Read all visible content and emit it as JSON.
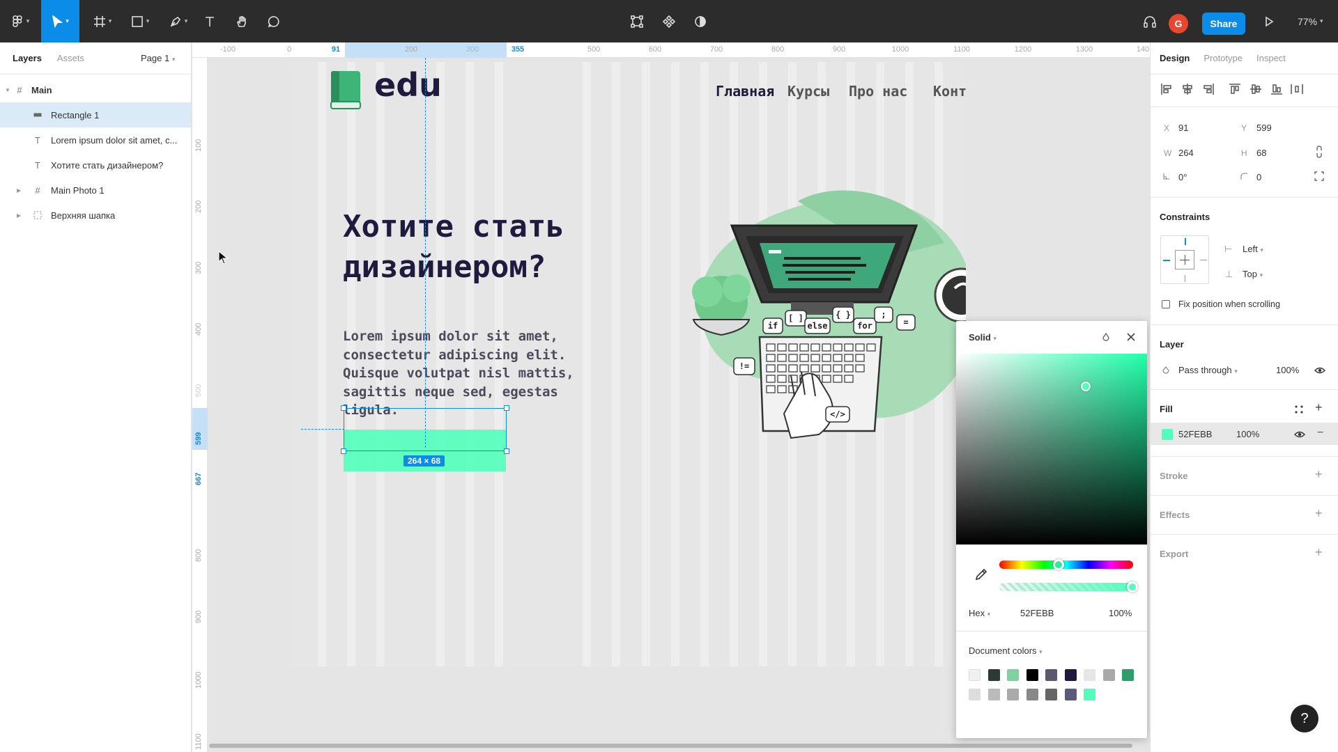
{
  "toolbar": {
    "share_label": "Share",
    "avatar_initial": "G",
    "zoom": "77%"
  },
  "left_panel": {
    "tabs": [
      "Layers",
      "Assets"
    ],
    "page": "Page 1",
    "layers": [
      {
        "label": "Main",
        "type": "frame"
      },
      {
        "label": "Rectangle 1",
        "type": "rect"
      },
      {
        "label": "Lorem ipsum dolor sit amet, c...",
        "type": "text"
      },
      {
        "label": "Хотите стать дизайнером?",
        "type": "text"
      },
      {
        "label": "Main Photo 1",
        "type": "frame"
      },
      {
        "label": "Верхняя шапка",
        "type": "group"
      }
    ]
  },
  "ruler": {
    "top": [
      "-100",
      "0",
      "91",
      "200",
      "300",
      "355",
      "500",
      "600",
      "700",
      "800",
      "900",
      "1000",
      "1100",
      "1200",
      "1300",
      "140"
    ],
    "left": [
      "100",
      "200",
      "300",
      "400",
      "500",
      "599",
      "667",
      "800",
      "900",
      "1000",
      "1100"
    ]
  },
  "site": {
    "logo": "edu",
    "nav": [
      "Главная",
      "Курсы",
      "Про нас",
      "Контакты"
    ],
    "hero_title": "Хотите стать дизайнером?",
    "hero_text": "Lorem ipsum dolor sit amet, consectetur adipiscing elit. Quisque volutpat nisl mattis, sagittis neque sed, egestas ligula.",
    "code_bubbles": [
      "if",
      "[ ]",
      "else",
      "{ }",
      "for",
      ";",
      "=",
      "!=",
      "</>"
    ]
  },
  "selection": {
    "size_label": "264 × 68"
  },
  "picker": {
    "mode": "Solid",
    "format": "Hex",
    "hex": "52FEBB",
    "opacity": "100%",
    "doc_colors_label": "Document colors",
    "swatches": [
      "#f0f0f0",
      "#2d3a33",
      "#7dd3a0",
      "#000000",
      "#5a5a6e",
      "#1e1b3f",
      "#e6e6e6",
      "#a9a9a9",
      "#2e9e6b",
      "#dddddd",
      "#bbbbbb",
      "#aaaaaa",
      "#888888",
      "#666666",
      "#5a5a7e",
      "#52febb"
    ]
  },
  "right_panel": {
    "tabs": [
      "Design",
      "Prototype",
      "Inspect"
    ],
    "x_label": "X",
    "x": "91",
    "y_label": "Y",
    "y": "599",
    "w_label": "W",
    "w": "264",
    "h_label": "H",
    "h": "68",
    "rotation": "0°",
    "radius": "0",
    "constraints_title": "Constraints",
    "constraint_h": "Left",
    "constraint_v": "Top",
    "fix_position": "Fix position when scrolling",
    "layer_title": "Layer",
    "blend": "Pass through",
    "layer_opacity": "100%",
    "fill_title": "Fill",
    "fill_hex": "52FEBB",
    "fill_opacity": "100%",
    "stroke_title": "Stroke",
    "effects_title": "Effects",
    "export_title": "Export"
  },
  "colors": {
    "accent": "#0c8ce9",
    "fill": "#52febb",
    "navy": "#1e1b3f"
  }
}
